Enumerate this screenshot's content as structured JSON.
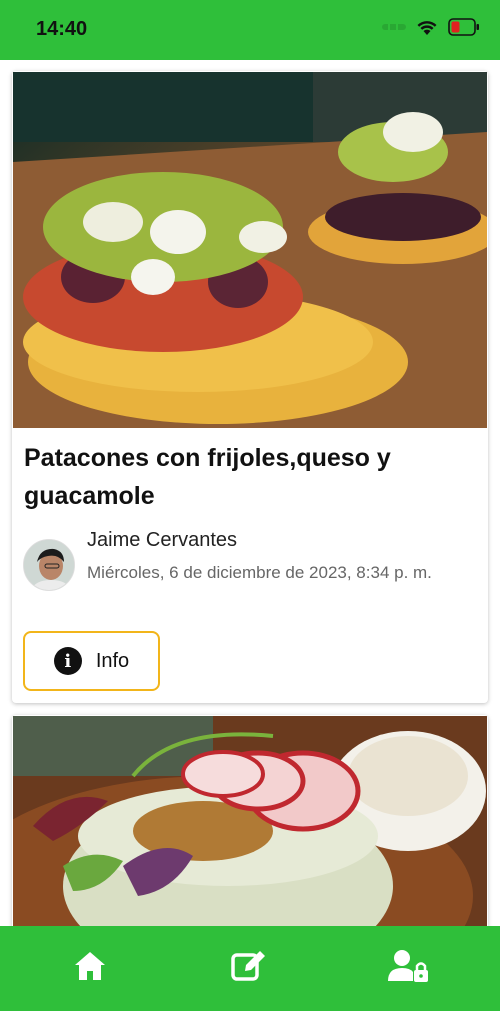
{
  "status_bar": {
    "time": "14:40"
  },
  "feed": {
    "posts": [
      {
        "title": "Patacones con frijoles,queso y guacamole",
        "author": "Jaime Cervantes",
        "date": "Miércoles, 6 de diciembre de 2023, 8:34 p. m.",
        "info_label": "Info"
      }
    ]
  },
  "bottom_nav": {
    "items": [
      {
        "icon": "home-icon"
      },
      {
        "icon": "edit-icon"
      },
      {
        "icon": "user-lock-icon"
      }
    ]
  },
  "colors": {
    "primary_green": "#2fbf3a",
    "info_border": "#f2b51a"
  }
}
